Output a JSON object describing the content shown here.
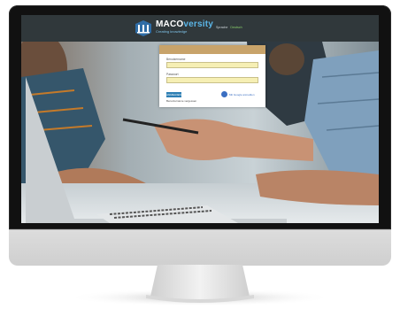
{
  "site": {
    "brand_main": "MACO",
    "brand_accent": "versity",
    "tagline": "Creating knowledge",
    "nav": [
      {
        "label": "Sprache"
      },
      {
        "label": "Deutsch",
        "active": true
      }
    ]
  },
  "login": {
    "username_label": "Benutzername",
    "username_value": "",
    "password_label": "Passwort",
    "password_value": "",
    "submit_label": "ANMELDEN",
    "google_label": "Mit Google anmelden",
    "forgot_label": "Benutzername vergessen"
  },
  "icons": {
    "logo": "macoversity-logo-icon",
    "google": "google-icon"
  },
  "colors": {
    "header_bg": "#30383b",
    "brand_accent": "#5bb6e8",
    "card_bar": "#c8a36a",
    "input_bg": "#f6efb4",
    "button": "#2e7fb4",
    "nav_active": "#8ad06b"
  }
}
